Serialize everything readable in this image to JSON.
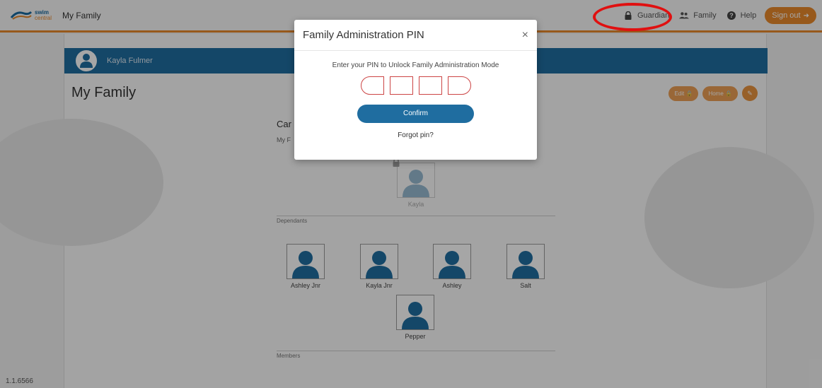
{
  "topbar": {
    "logo_main": "swim",
    "logo_sub": "central",
    "title": "My Family",
    "nav": {
      "guardian": "Guardian",
      "family": "Family",
      "help": "Help",
      "signout": "Sign out"
    }
  },
  "profile": {
    "name": "Kayla Fulmer"
  },
  "page": {
    "title": "My Family",
    "edit_label": "Edit",
    "home_label": "Home"
  },
  "card": {
    "title_partial": "Car",
    "sub_partial": "My F"
  },
  "guardian_person": {
    "name": "Kayla"
  },
  "sections": {
    "dependants": "Dependants",
    "members": "Members"
  },
  "dependants": [
    {
      "name": "Ashley Jnr"
    },
    {
      "name": "Kayla Jnr"
    },
    {
      "name": "Ashley"
    },
    {
      "name": "Salt"
    },
    {
      "name": "Pepper"
    }
  ],
  "version": "1.1.6566",
  "modal": {
    "title": "Family Administration PIN",
    "close": "×",
    "instruction": "Enter your PIN to Unlock Family Administration Mode",
    "confirm": "Confirm",
    "forgot": "Forgot pin?"
  },
  "colors": {
    "brand_blue": "#1f6da0",
    "brand_orange": "#e8892c",
    "annotation_red": "#e01010"
  }
}
